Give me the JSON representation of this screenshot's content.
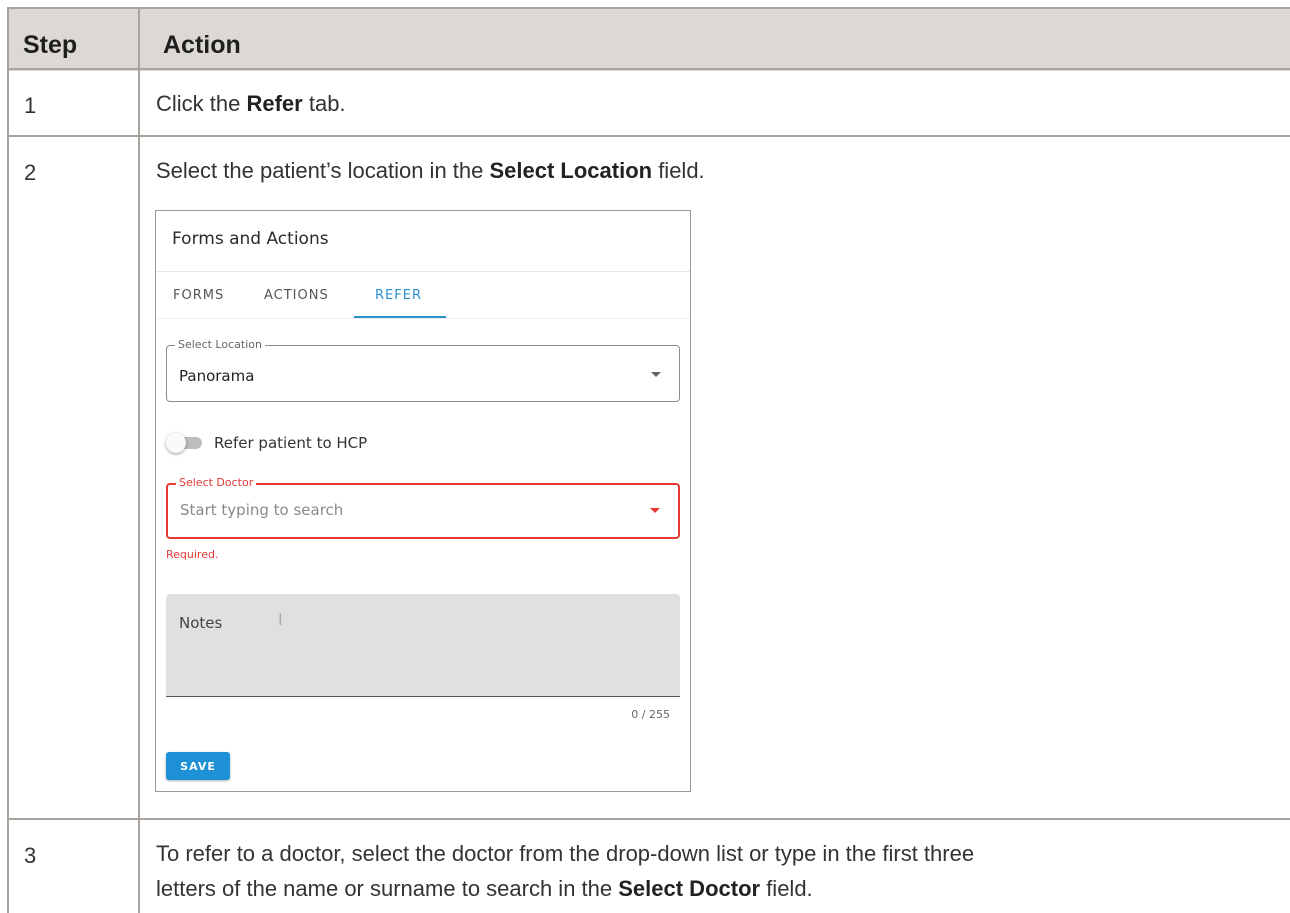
{
  "header": {
    "step_label": "Step",
    "action_label": "Action"
  },
  "rows": [
    {
      "step": "1",
      "pre": "Click the ",
      "bold": "Refer",
      "post": " tab."
    },
    {
      "step": "2",
      "pre": "Select the patient’s location in the ",
      "bold": "Select Location",
      "post": " field."
    },
    {
      "step": "3",
      "line1": "To refer to a doctor, select the doctor from the drop-down list or type in the first three",
      "line2_pre": "letters of the name or surname to search in the ",
      "line2_bold": "Select Doctor",
      "line2_post": " field."
    }
  ],
  "panel": {
    "title": "Forms and Actions",
    "tabs": [
      "FORMS",
      "ACTIONS",
      "REFER"
    ],
    "active_tab": "REFER",
    "location_label": "Select Location",
    "location_value": "Panorama",
    "toggle_label": "Refer patient to HCP",
    "toggle_on": false,
    "doctor_label": "Select Doctor",
    "doctor_placeholder": "Start typing to search",
    "required_text": "Required.",
    "notes_label": "Notes",
    "notes_counter": "0 / 255",
    "save_label": "SAVE"
  },
  "colors": {
    "header_bg": "#dcd8d3",
    "accent": "#2b8fd0",
    "error": "#e53935",
    "save_button": "#1e90d6"
  }
}
